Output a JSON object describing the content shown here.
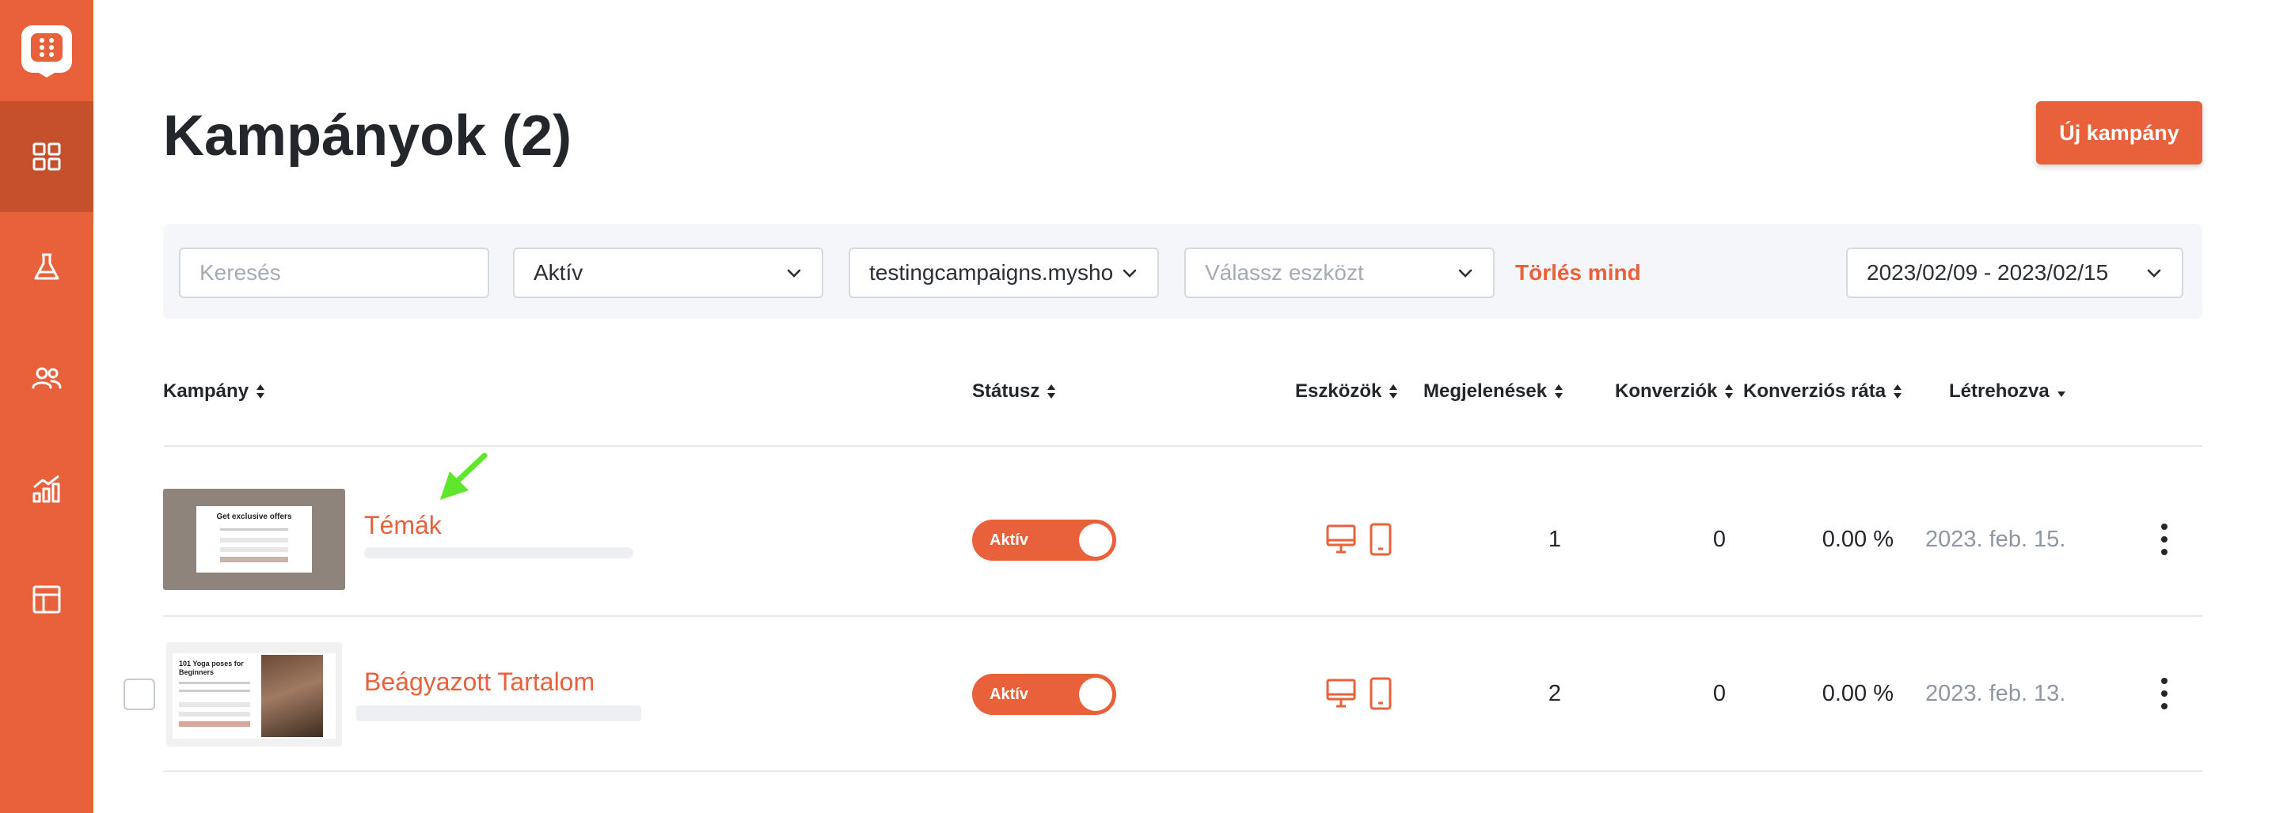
{
  "app": {
    "title": "Kampányok (2)",
    "new_button": "Új kampány",
    "accent_color": "#e8613a"
  },
  "sidebar": {
    "logo": "app-logo-icon",
    "items": [
      {
        "name": "dashboard",
        "icon": "grid-icon",
        "active": true
      },
      {
        "name": "experiments",
        "icon": "flask-icon",
        "active": false
      },
      {
        "name": "users",
        "icon": "users-icon",
        "active": false
      },
      {
        "name": "analytics",
        "icon": "chart-icon",
        "active": false
      },
      {
        "name": "templates",
        "icon": "layout-icon",
        "active": false
      }
    ]
  },
  "filters": {
    "search_placeholder": "Keresés",
    "status_value": "Aktív",
    "domain_value": "testingcampaigns.mysho",
    "device_placeholder": "Válassz eszközt",
    "clear_all": "Törlés mind",
    "date_range": "2023/02/09 - 2023/02/15"
  },
  "table": {
    "columns": {
      "campaign": "Kampány",
      "status": "Státusz",
      "devices": "Eszközök",
      "impressions": "Megjelenések",
      "conversions": "Konverziók",
      "conversion_rate": "Konverziós ráta",
      "created": "Létrehozva"
    },
    "rows": [
      {
        "name": "Témák",
        "status": "Aktív",
        "devices": [
          "desktop-icon",
          "mobile-icon"
        ],
        "impressions": "1",
        "conversions": "0",
        "conversion_rate": "0.00 %",
        "created": "2023. feb. 15.",
        "thumb_title": "Get exclusive offers"
      },
      {
        "name": "Beágyazott Tartalom",
        "status": "Aktív",
        "devices": [
          "desktop-icon",
          "mobile-icon"
        ],
        "impressions": "2",
        "conversions": "0",
        "conversion_rate": "0.00 %",
        "created": "2023. feb. 13.",
        "thumb_title": "101 Yoga poses for Beginners"
      }
    ]
  }
}
